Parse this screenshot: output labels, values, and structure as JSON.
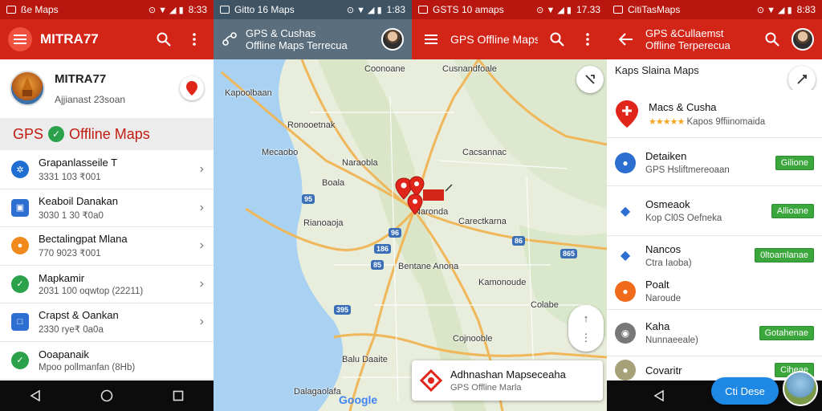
{
  "colors": {
    "app_red": "#d32418",
    "status_red": "#b8170f",
    "map_water": "#a9d2f2",
    "map_land": "#e8eddc",
    "tag_green": "#3aa63c",
    "fab_blue": "#1e88e5"
  },
  "panel1": {
    "status": {
      "text": "ße Maps",
      "time": "8:33"
    },
    "appbar": {
      "title": "MITRA77",
      "menu_icon": "hamburger-icon",
      "search_icon": "search-icon",
      "more_icon": "more-vert-icon"
    },
    "profile": {
      "name": "MITRA77",
      "subtitle": "Ajjianast 23soan"
    },
    "banner": {
      "left": "GPS",
      "right": "Offline Maps"
    },
    "rows": [
      {
        "title": "Grapanlasseile T",
        "sub": "3331 103 ₹001",
        "color": "#1e6fd1",
        "icon": "✲"
      },
      {
        "title": "Keaboil Danakan",
        "sub": "3030 1 30 ₹0a0",
        "color": "#2d6fd0",
        "icon": "▣"
      },
      {
        "title": "Bectalingpat Mlana",
        "sub": "770 9023 ₹001",
        "color": "#f08a1c",
        "icon": "●"
      },
      {
        "title": "Mapkamir",
        "sub": "2031 100 oqwtop (22211)",
        "color": "#2aa14a",
        "icon": "✓"
      },
      {
        "title": "Crapst & Oankan",
        "sub": "2330 rye₹ 0a0a",
        "color": "#2d6fd0",
        "icon": "□"
      },
      {
        "title": "Ooapanaik",
        "sub": "Mpoo pollmanfan (8Hb)",
        "color": "#2aa14a",
        "icon": "✓"
      }
    ]
  },
  "panel2": {
    "status": {
      "text": "Gitto 16 Maps",
      "time": "1:83"
    },
    "topbar": {
      "line1": "GPS & Cushas",
      "line2": "Offline Maps Terrecua"
    },
    "labels": [
      "Kapoolbaan",
      "Ronooetnak",
      "Mecaobo",
      "Naraobla",
      "Boala",
      "Rianoaoja",
      "Bentane Anona",
      "Balu Daaite",
      "Dalagaolafa",
      "Coonoane",
      "Naronda"
    ],
    "shields": [
      "95",
      "96",
      "186",
      "395",
      "85"
    ],
    "google": "Google"
  },
  "panel3": {
    "status": {
      "text": "GSTS 10 amaps",
      "time": "17.33"
    },
    "appbar": {
      "title": "GPS Offline Maps"
    },
    "labels": [
      "Cusnandfoale",
      "Cacsannac",
      "Carectkarna",
      "Kamonoude",
      "Colabe",
      "Cojnooble"
    ],
    "shields": [
      "86",
      "865"
    ],
    "search": {
      "title": "Adhnashan Mapseceaha",
      "sub": "GPS Offline Marla"
    }
  },
  "panel4": {
    "status": {
      "text": "CitiTasMaps",
      "time": "8:83"
    },
    "appbar": {
      "line1": "GPS &Cullaemst",
      "line2": "Offline Terperecua"
    },
    "heading": "Kaps Slaina Maps",
    "featured": {
      "title": "Macs & Cusha",
      "stars": "★★★★★",
      "sub": "Kapos 9ffiinomaida"
    },
    "rows": [
      {
        "title": "Detaiken",
        "sub": "GPS Hsliftmereoaan",
        "tag": "Gilione",
        "color": "#2d6fd0",
        "icon": "●"
      },
      {
        "title": "Osmeaok",
        "sub": "Kop Cl0S Oefneka",
        "tag": "Allioane",
        "color": "#2d6fd0",
        "icon": "◆"
      },
      {
        "title": "Nancos",
        "sub": "Ctra Iaoba)",
        "tag": "0ltoamlanae",
        "color": "#2d6fd0",
        "icon": "◆"
      },
      {
        "title": "Poalt",
        "sub": "Naroude",
        "tag": "",
        "color": "#f06a1c",
        "icon": "●"
      },
      {
        "title": "Kaha",
        "sub": "Nunnaeeale)",
        "tag": "Gotahenae",
        "color": "#777",
        "icon": "◉"
      },
      {
        "title": "Covaritr",
        "sub": "",
        "tag": "Ciheae",
        "color": "#a7a17a",
        "icon": "●"
      }
    ],
    "cta": "Cti Dese"
  }
}
